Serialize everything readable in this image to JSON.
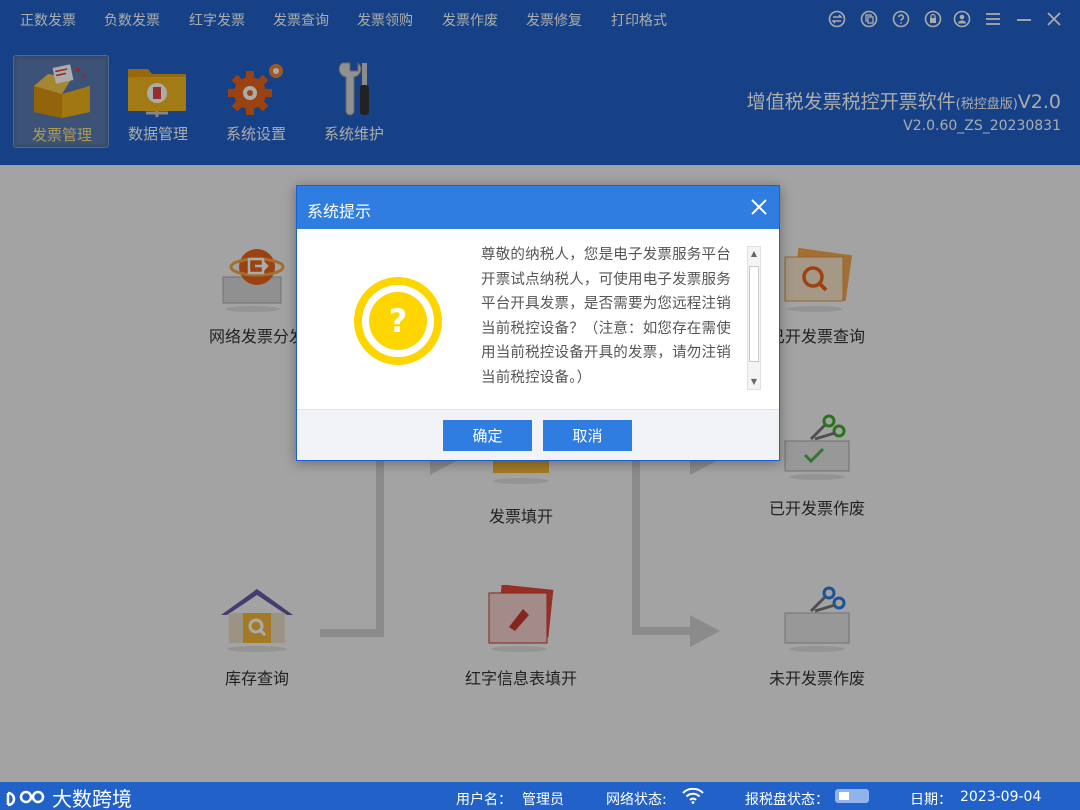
{
  "menu": [
    "正数发票",
    "负数发票",
    "红字发票",
    "发票查询",
    "发票领购",
    "发票作废",
    "发票修复",
    "打印格式"
  ],
  "window_controls": [
    "swap-icon",
    "copy-icon",
    "help-icon",
    "lock-icon",
    "user-icon",
    "menu-icon",
    "minimize-icon",
    "close-icon"
  ],
  "modules": [
    {
      "label": "发票管理",
      "icon": "invoice-box-icon",
      "active": true
    },
    {
      "label": "数据管理",
      "icon": "data-folder-icon",
      "active": false
    },
    {
      "label": "系统设置",
      "icon": "settings-gear-icon",
      "active": false
    },
    {
      "label": "系统维护",
      "icon": "tools-icon",
      "active": false
    }
  ],
  "app": {
    "title": "增值税发票税控开票软件",
    "edition": "(税控盘版)",
    "title_version": "V2.0",
    "version": "V2.0.60_ZS_20230831"
  },
  "features": {
    "network_invoice": "网络发票分发",
    "issued_query": "已开发票查询",
    "invoice_fill": "发票填开",
    "issued_void": "已开发票作废",
    "stock_query": "库存查询",
    "red_info_fill": "红字信息表填开",
    "unissued_void": "未开发票作废"
  },
  "dialog": {
    "title": "系统提示",
    "message": "尊敬的纳税人，您是电子发票服务平台开票试点纳税人，可使用电子发票服务平台开具发票，是否需要为您远程注销当前税控设备？（注意：如您存在需使用当前税控设备开具的发票，请勿注销当前税控设备。）",
    "confirm_label": "确定",
    "cancel_label": "取消",
    "icon": "question-icon"
  },
  "watermark": "大数跨境",
  "status": {
    "user_label": "用户名：",
    "user_value": "管理员",
    "network_label": "网络状态:",
    "tax_disk_label": "报税盘状态：",
    "date_label": "日期：",
    "date_value": "2023-09-04"
  },
  "colors": {
    "primary": "#2262c8",
    "dialog_accent": "#2f7de1",
    "question_yellow": "#ffd500"
  }
}
